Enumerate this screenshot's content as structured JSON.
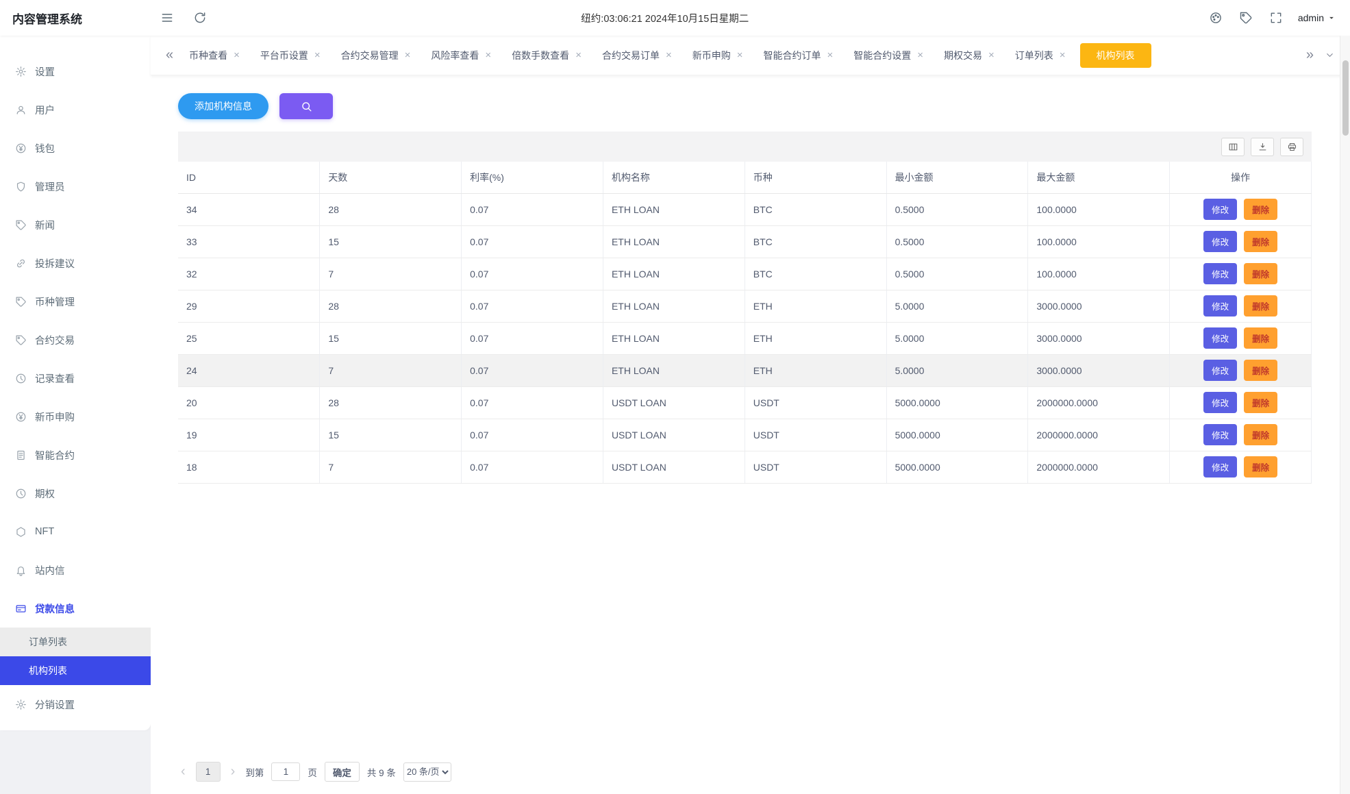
{
  "app": {
    "title": "内容管理系统",
    "clock": "纽约:03:06:21 2024年10月15日星期二",
    "user": "admin"
  },
  "colors": {
    "sidebar_active": "#3b49e8",
    "tab_active": "#fcb612",
    "primary_button": "#2e9af0",
    "search_button": "#7b5bf2",
    "edit_button": "#5a5fe3",
    "delete_button": "#ffa02f"
  },
  "sidebar": {
    "items": [
      {
        "label": "设置",
        "icon": "gear"
      },
      {
        "label": "用户",
        "icon": "user"
      },
      {
        "label": "钱包",
        "icon": "wallet"
      },
      {
        "label": "管理员",
        "icon": "shield"
      },
      {
        "label": "新闻",
        "icon": "news"
      },
      {
        "label": "投拆建议",
        "icon": "link"
      },
      {
        "label": "币种管理",
        "icon": "coin"
      },
      {
        "label": "合约交易",
        "icon": "contract"
      },
      {
        "label": "记录查看",
        "icon": "history"
      },
      {
        "label": "新币申购",
        "icon": "subscribe"
      },
      {
        "label": "智能合约",
        "icon": "smart-contract"
      },
      {
        "label": "期权",
        "icon": "option"
      },
      {
        "label": "NFT",
        "icon": "nft"
      },
      {
        "label": "站内信",
        "icon": "message"
      },
      {
        "label": "贷款信息",
        "icon": "loan",
        "active": true,
        "children": [
          {
            "label": "订单列表"
          },
          {
            "label": "机构列表",
            "selected": true
          }
        ]
      },
      {
        "label": "分销设置",
        "icon": "distribution"
      }
    ]
  },
  "tabs": {
    "scroll_left": "«",
    "scroll_right": "»",
    "items": [
      {
        "label": "币种查看"
      },
      {
        "label": "平台币设置"
      },
      {
        "label": "合约交易管理"
      },
      {
        "label": "风险率查看"
      },
      {
        "label": "倍数手数查看"
      },
      {
        "label": "合约交易订单"
      },
      {
        "label": "新币申购"
      },
      {
        "label": "智能合约订单"
      },
      {
        "label": "智能合约设置"
      },
      {
        "label": "期权交易"
      },
      {
        "label": "订单列表"
      },
      {
        "label": "机构列表",
        "active": true
      }
    ]
  },
  "actions": {
    "add_label": "添加机构信息"
  },
  "table": {
    "headers": [
      "ID",
      "天数",
      "利率(%)",
      "机构名称",
      "币种",
      "最小金额",
      "最大金额",
      "操作"
    ],
    "edit_label": "修改",
    "delete_label": "删除",
    "rows": [
      {
        "cells": [
          "34",
          "28",
          "0.07",
          "ETH LOAN",
          "BTC",
          "0.5000",
          "100.0000"
        ],
        "highlight": false
      },
      {
        "cells": [
          "33",
          "15",
          "0.07",
          "ETH LOAN",
          "BTC",
          "0.5000",
          "100.0000"
        ],
        "highlight": false
      },
      {
        "cells": [
          "32",
          "7",
          "0.07",
          "ETH LOAN",
          "BTC",
          "0.5000",
          "100.0000"
        ],
        "highlight": false
      },
      {
        "cells": [
          "29",
          "28",
          "0.07",
          "ETH LOAN",
          "ETH",
          "5.0000",
          "3000.0000"
        ],
        "highlight": false
      },
      {
        "cells": [
          "25",
          "15",
          "0.07",
          "ETH LOAN",
          "ETH",
          "5.0000",
          "3000.0000"
        ],
        "highlight": false
      },
      {
        "cells": [
          "24",
          "7",
          "0.07",
          "ETH LOAN",
          "ETH",
          "5.0000",
          "3000.0000"
        ],
        "highlight": true
      },
      {
        "cells": [
          "20",
          "28",
          "0.07",
          "USDT LOAN",
          "USDT",
          "5000.0000",
          "2000000.0000"
        ],
        "highlight": false
      },
      {
        "cells": [
          "19",
          "15",
          "0.07",
          "USDT LOAN",
          "USDT",
          "5000.0000",
          "2000000.0000"
        ],
        "highlight": false
      },
      {
        "cells": [
          "18",
          "7",
          "0.07",
          "USDT LOAN",
          "USDT",
          "5000.0000",
          "2000000.0000"
        ],
        "highlight": false
      }
    ]
  },
  "pagination": {
    "prev": "‹",
    "next": "›",
    "current_page": "1",
    "goto_prefix": "到第",
    "goto_value": "1",
    "goto_suffix": "页",
    "confirm_label": "确定",
    "total_label": "共 9 条",
    "page_size_label": "20 条/页"
  }
}
